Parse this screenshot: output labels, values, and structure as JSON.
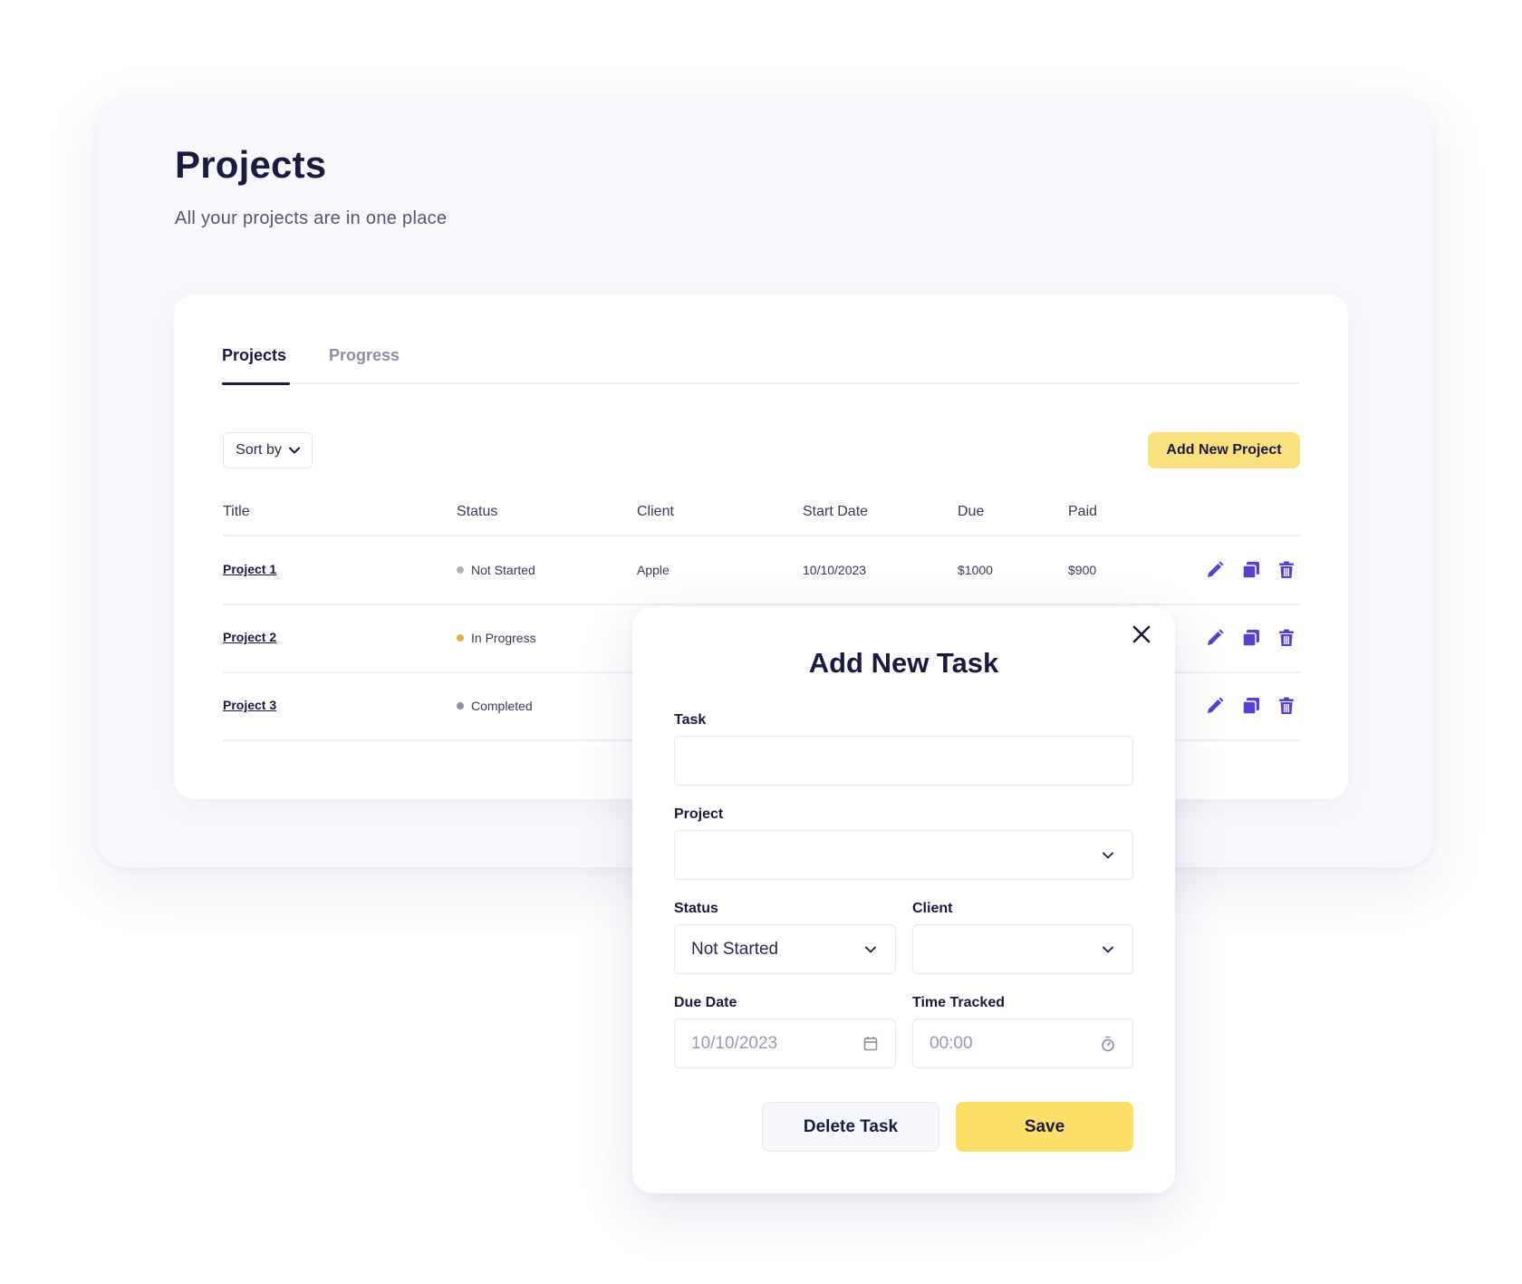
{
  "page": {
    "title": "Projects",
    "subtitle": "All your projects are in one place"
  },
  "tabs": [
    {
      "label": "Projects",
      "active": true
    },
    {
      "label": "Progress",
      "active": false
    }
  ],
  "toolbar": {
    "sort_label": "Sort by",
    "add_label": "Add New Project"
  },
  "table": {
    "columns": [
      "Title",
      "Status",
      "Client",
      "Start Date",
      "Due",
      "Paid"
    ],
    "rows": [
      {
        "title": "Project 1",
        "status": "Not Started",
        "status_color": "#b3b3c0",
        "client": "Apple",
        "start_date": "10/10/2023",
        "due": "$1000",
        "paid": "$900"
      },
      {
        "title": "Project 2",
        "status": "In Progress",
        "status_color": "#d9b345",
        "client": "",
        "start_date": "",
        "due": "",
        "paid": ""
      },
      {
        "title": "Project 3",
        "status": "Completed",
        "status_color": "#8e8fa0",
        "client": "",
        "start_date": "",
        "due": "",
        "paid": ""
      }
    ],
    "row_actions": [
      "edit-icon",
      "duplicate-icon",
      "trash-icon"
    ]
  },
  "modal": {
    "title": "Add New Task",
    "fields": {
      "task": {
        "label": "Task",
        "value": ""
      },
      "project": {
        "label": "Project",
        "value": ""
      },
      "status": {
        "label": "Status",
        "value": "Not Started"
      },
      "client": {
        "label": "Client",
        "value": ""
      },
      "due_date": {
        "label": "Due Date",
        "placeholder": "10/10/2023"
      },
      "time_tracked": {
        "label": "Time Tracked",
        "placeholder": "00:00"
      }
    },
    "delete_label": "Delete Task",
    "save_label": "Save"
  },
  "colors": {
    "accent_yellow": "#fde068",
    "icon_purple": "#5a3fd0",
    "text_dark": "#1b1a3f"
  }
}
